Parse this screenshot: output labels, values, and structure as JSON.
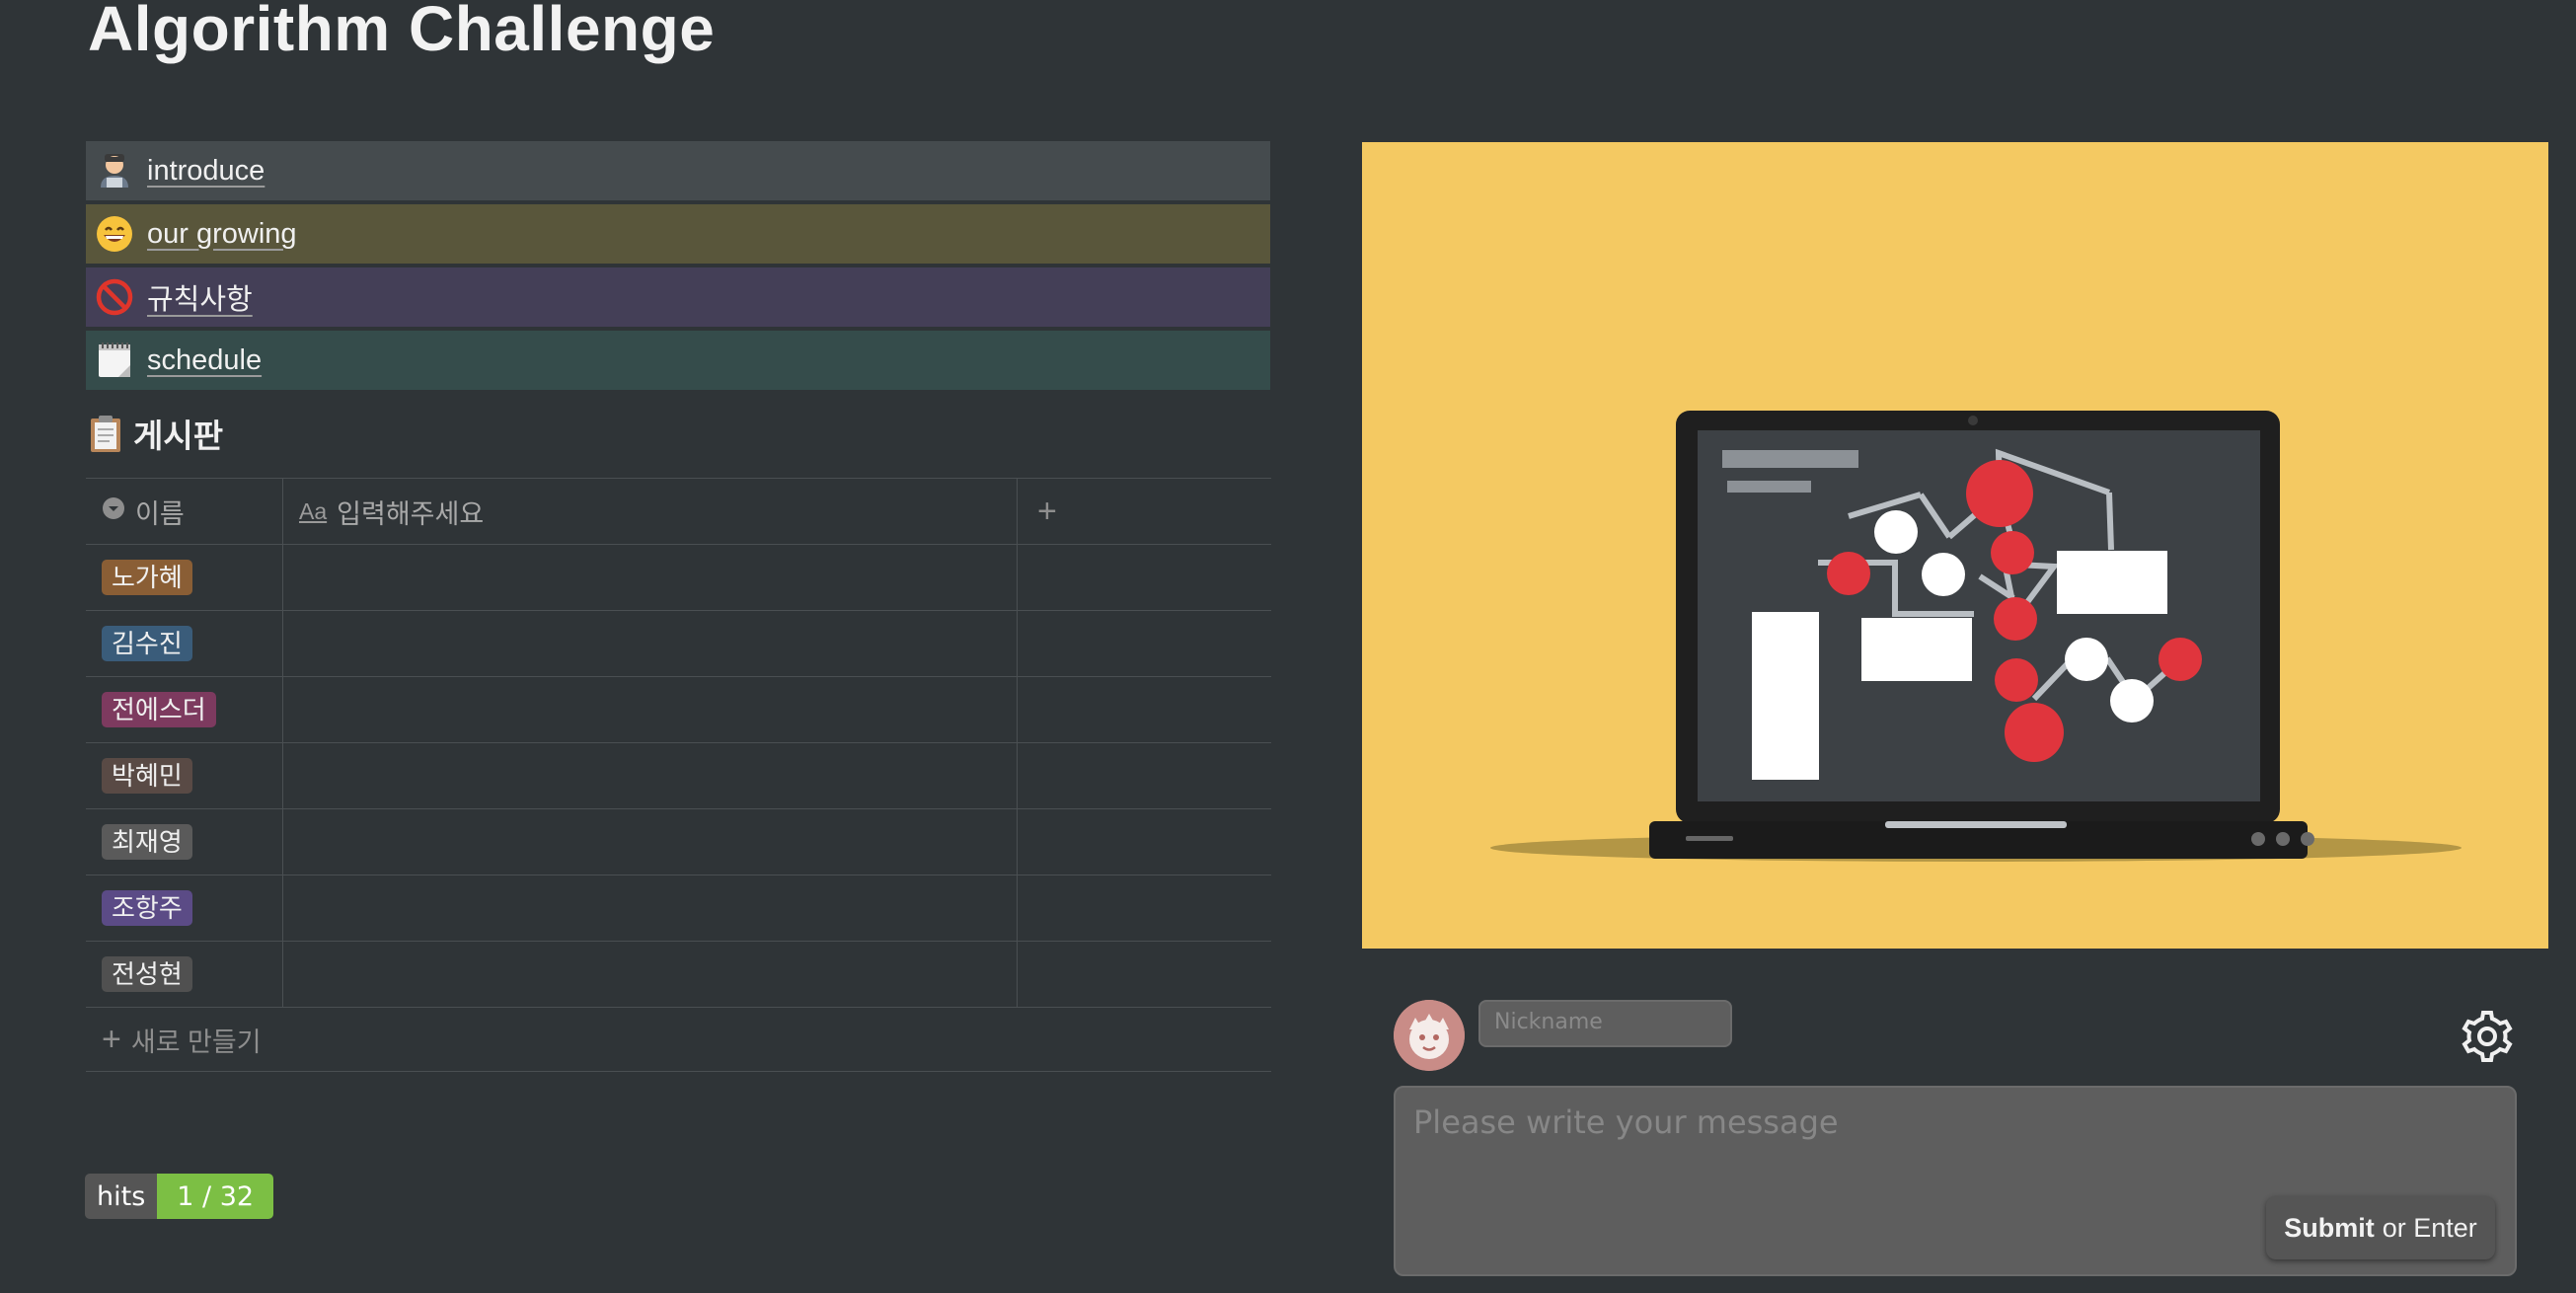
{
  "page": {
    "title": "Algorithm Challenge"
  },
  "callouts": [
    {
      "icon": "technologist-icon",
      "label": "introduce"
    },
    {
      "icon": "grinning-face-icon",
      "label": "our growing"
    },
    {
      "icon": "no-entry-icon",
      "label": "규칙사항"
    },
    {
      "icon": "calendar-icon",
      "label": "schedule"
    }
  ],
  "board": {
    "title": "게시판",
    "icon": "clipboard-icon",
    "columns": {
      "name": "이름",
      "title_prop": "입력해주세요"
    },
    "rows": [
      {
        "name": "노가혜",
        "color": "#8a5e35"
      },
      {
        "name": "김수진",
        "color": "#3a5c7a"
      },
      {
        "name": "전에스더",
        "color": "#7d3a5f"
      },
      {
        "name": "박혜민",
        "color": "#594a45"
      },
      {
        "name": "최재영",
        "color": "#5a5a5a"
      },
      {
        "name": "조항주",
        "color": "#5b4b86"
      },
      {
        "name": "전성현",
        "color": "#505050"
      }
    ],
    "new_label": "새로 만들기"
  },
  "hits": {
    "label": "hits",
    "value": "1 / 32"
  },
  "comments": {
    "nickname_placeholder": "Nickname",
    "message_placeholder": "Please write your message",
    "submit_label": "Submit",
    "submit_hint": "or Enter"
  },
  "colors": {
    "background": "#2f3437",
    "cover": "#f4c962",
    "hits_badge": "#7cbf44"
  }
}
